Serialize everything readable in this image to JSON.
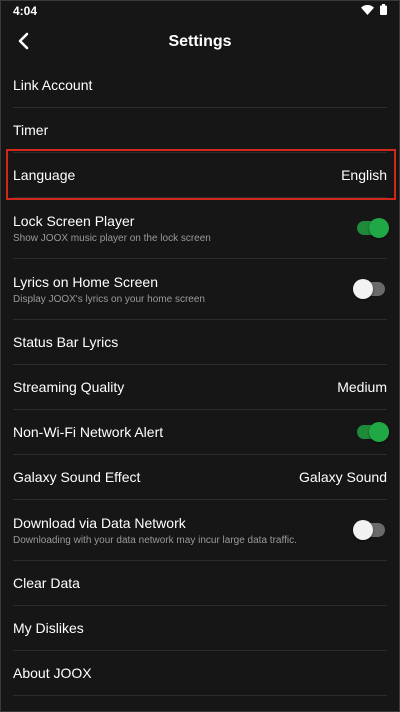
{
  "status_bar": {
    "time": "4:04"
  },
  "header": {
    "title": "Settings"
  },
  "rows": [
    {
      "label": "Link Account"
    },
    {
      "label": "Timer"
    },
    {
      "label": "Language",
      "value": "English"
    },
    {
      "label": "Lock Screen Player",
      "sub": "Show JOOX music player on the lock screen",
      "toggle": "on"
    },
    {
      "label": "Lyrics on Home Screen",
      "sub": "Display JOOX's lyrics on your home screen",
      "toggle": "off"
    },
    {
      "label": "Status Bar Lyrics"
    },
    {
      "label": "Streaming Quality",
      "value": "Medium"
    },
    {
      "label": "Non-Wi-Fi Network Alert",
      "toggle": "on"
    },
    {
      "label": "Galaxy Sound Effect",
      "value": "Galaxy Sound"
    },
    {
      "label": "Download via Data Network",
      "sub": "Downloading with your data network may incur large data traffic.",
      "toggle": "off"
    },
    {
      "label": "Clear Data"
    },
    {
      "label": "My Dislikes"
    },
    {
      "label": "About JOOX"
    }
  ],
  "colors": {
    "background": "#161616",
    "highlight": "#d3271b",
    "toggle_on": "#1fa845",
    "toggle_off_knob": "#f2f2f2"
  },
  "icons": {
    "back": "chevron-left-icon",
    "wifi": "wifi-icon",
    "battery": "battery-icon"
  }
}
